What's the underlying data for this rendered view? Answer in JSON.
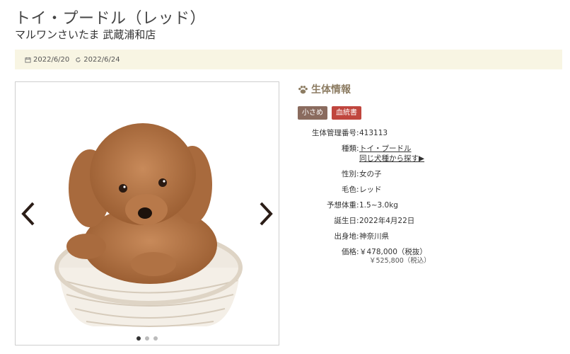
{
  "header": {
    "title": "トイ・プードル（レッド）",
    "subtitle": "マルワンさいたま 武蔵浦和店"
  },
  "dates": {
    "posted": "2022/6/20",
    "updated": "2022/6/24"
  },
  "gallery": {
    "dots": 3,
    "active_index": 0
  },
  "info": {
    "heading": "生体情報",
    "tags": [
      "小さめ",
      "血統書"
    ],
    "management_no_label": "生体管理番号",
    "management_no": "413113",
    "breed_label": "種類",
    "breed_link": "トイ・プードル",
    "same_breed_link": "同じ犬種から探す▶",
    "sex_label": "性別",
    "sex": "女の子",
    "color_label": "毛色",
    "color": "レッド",
    "weight_label": "予想体重",
    "weight": "1.5~3.0kg",
    "birthday_label": "誕生日",
    "birthday": "2022年4月22日",
    "origin_label": "出身地",
    "origin": "神奈川県",
    "price_label": "価格",
    "price_ex_tax": "￥478,000（税抜）",
    "price_in_tax": "￥525,800（税込）"
  },
  "colors": {
    "date_bar_bg": "#f8f5e3",
    "heading": "#8c7c62",
    "tag_small": "#8a6b5e",
    "tag_blood": "#c0463e"
  },
  "icons": [
    "calendar-icon",
    "refresh-icon",
    "paw-icon",
    "chevron-left-icon",
    "chevron-right-icon"
  ]
}
